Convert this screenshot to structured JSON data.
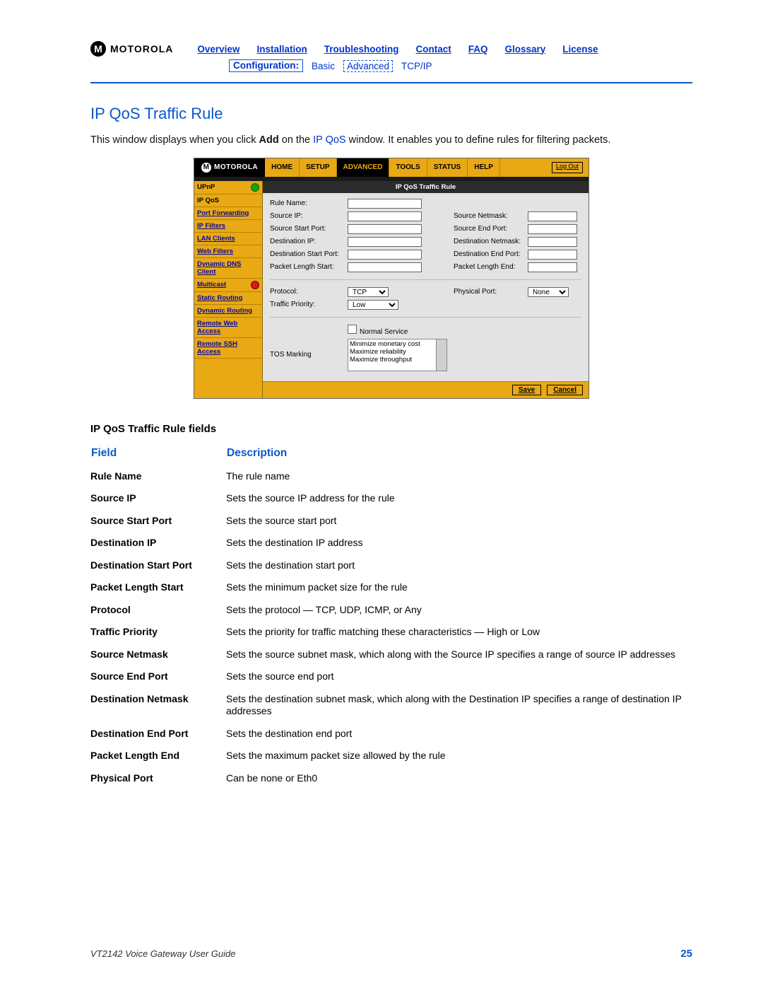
{
  "brand": "MOTOROLA",
  "top_nav": {
    "overview": "Overview",
    "installation": "Installation",
    "troubleshooting": "Troubleshooting",
    "contact": "Contact",
    "faq": "FAQ",
    "glossary": "Glossary",
    "license": "License"
  },
  "sub_nav": {
    "label": "Configuration:",
    "basic": "Basic",
    "advanced": "Advanced",
    "tcpip": "TCP/IP"
  },
  "section_title": "IP QoS Traffic Rule",
  "intro_before": "This window displays when you click ",
  "intro_bold": "Add",
  "intro_mid": " on the ",
  "intro_link": "IP QoS",
  "intro_after": " window. It enables you to define rules for filtering packets.",
  "shot": {
    "brand": "MOTOROLA",
    "tabs": {
      "home": "HOME",
      "setup": "SETUP",
      "advanced": "ADVANCED",
      "tools": "TOOLS",
      "status": "STATUS",
      "help": "HELP"
    },
    "logout": "Log Out",
    "sidebar": {
      "upnp": "UPnP",
      "ipqos": "IP QoS",
      "port_forwarding": "Port Forwarding",
      "ip_filters": "IP Filters",
      "lan_clients": "LAN Clients",
      "web_filters": "Web Filters",
      "ddns": "Dynamic DNS Client",
      "multicast": "Multicast",
      "static_routing": "Static Routing",
      "dynamic_routing": "Dynamic Routing",
      "remote_web": "Remote Web Access",
      "remote_ssh": "Remote SSH Access"
    },
    "panel_title": "IP QoS Traffic Rule",
    "form": {
      "rule_name": "Rule Name:",
      "source_ip": "Source IP:",
      "source_netmask": "Source Netmask:",
      "source_start_port": "Source Start Port:",
      "source_end_port": "Source End Port:",
      "destination_ip": "Destination IP:",
      "destination_netmask": "Destination Netmask:",
      "destination_start_port": "Destination Start Port:",
      "destination_end_port": "Destination End Port:",
      "packet_length_start": "Packet Length Start:",
      "packet_length_end": "Packet Length End:",
      "protocol": "Protocol:",
      "protocol_value": "TCP",
      "physical_port": "Physical Port:",
      "physical_port_value": "None",
      "traffic_priority": "Traffic Priority:",
      "traffic_priority_value": "Low",
      "normal_service": "Normal Service",
      "tos_marking": "TOS Marking",
      "tos_opts": {
        "a": "Minimize monetary cost",
        "b": "Maximize reliability",
        "c": "Maximize throughput"
      }
    },
    "buttons": {
      "save": "Save",
      "cancel": "Cancel"
    }
  },
  "fields_caption": "IP QoS Traffic Rule fields",
  "fields_headers": {
    "field": "Field",
    "desc": "Description"
  },
  "fields": [
    {
      "f": "Rule Name",
      "d": "The rule name"
    },
    {
      "f": "Source IP",
      "d": "Sets the source IP address for the rule"
    },
    {
      "f": "Source Start Port",
      "d": "Sets the source start port"
    },
    {
      "f": "Destination IP",
      "d": "Sets the destination IP address"
    },
    {
      "f": "Destination Start Port",
      "d": "Sets the destination start port"
    },
    {
      "f": "Packet Length Start",
      "d": "Sets the minimum packet size for the rule"
    },
    {
      "f": "Protocol",
      "d": "Sets the protocol — TCP, UDP, ICMP, or Any"
    },
    {
      "f": "Traffic Priority",
      "d": "Sets the priority for traffic matching these characteristics — High or Low"
    },
    {
      "f": "Source Netmask",
      "d": "Sets the source subnet mask, which along with the Source IP specifies a range of source IP addresses"
    },
    {
      "f": "Source End Port",
      "d": "Sets the source end port"
    },
    {
      "f": "Destination Netmask",
      "d": "Sets the destination subnet mask, which along with the Destination IP specifies a range of destination IP addresses"
    },
    {
      "f": "Destination End Port",
      "d": "Sets the destination end port"
    },
    {
      "f": "Packet Length End",
      "d": "Sets the maximum packet size allowed by the rule"
    },
    {
      "f": "Physical Port",
      "d": "Can be none or Eth0"
    }
  ],
  "footer": {
    "guide": "VT2142 Voice Gateway User Guide",
    "page": "25"
  }
}
